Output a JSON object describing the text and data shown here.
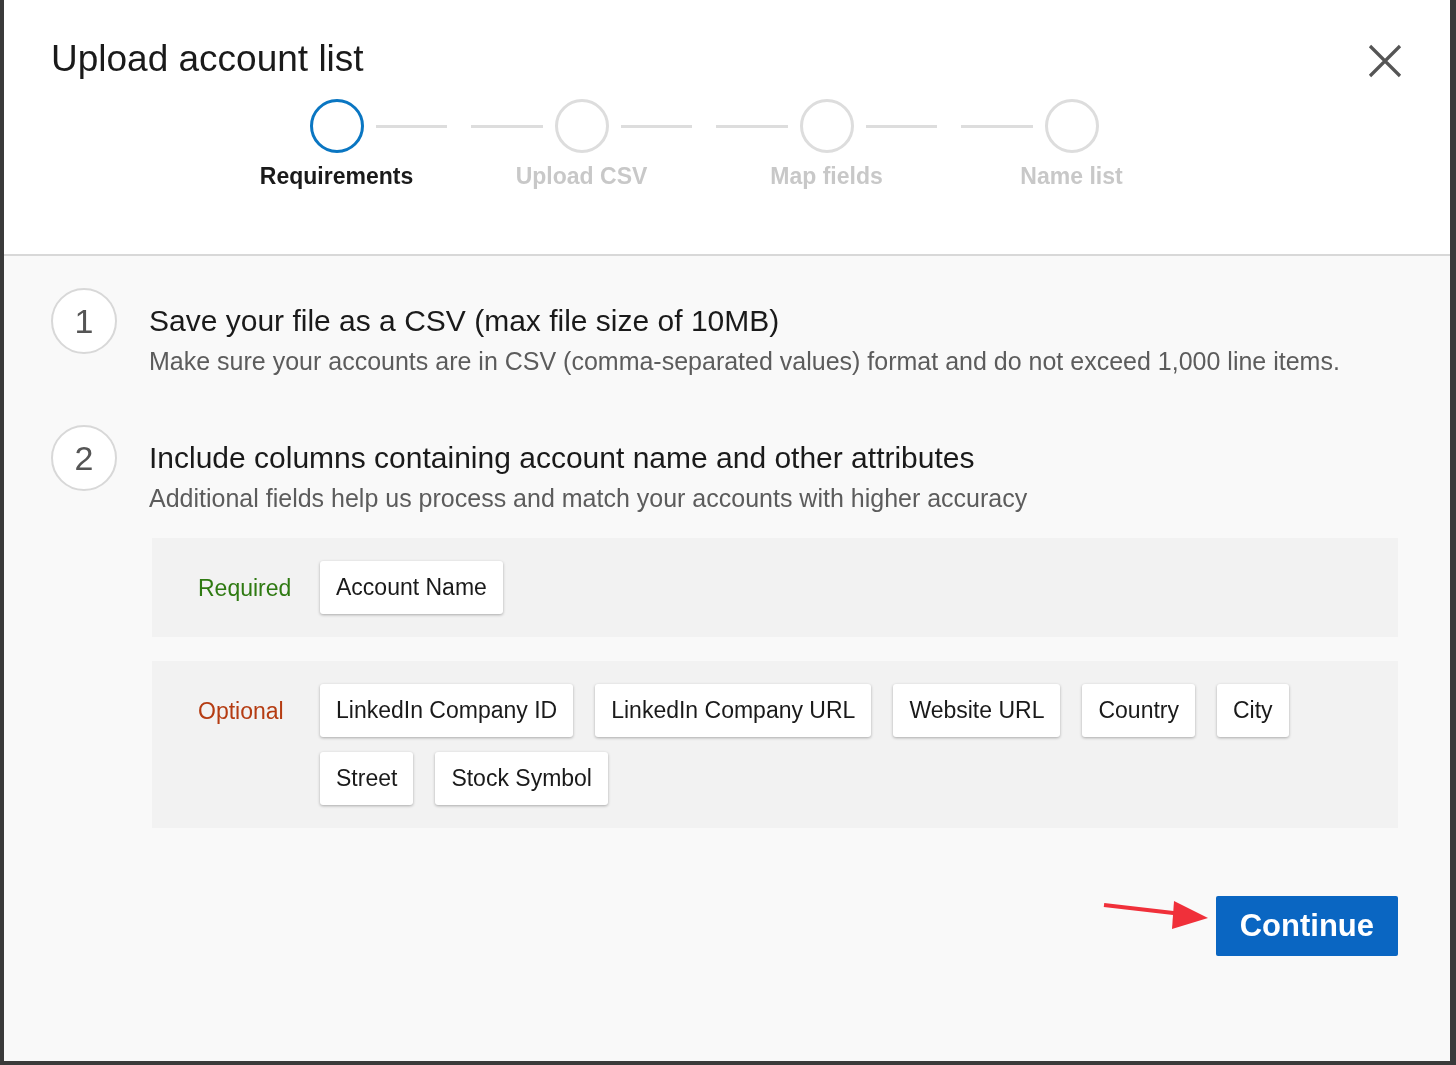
{
  "dialog": {
    "title": "Upload account list"
  },
  "steps": [
    {
      "label": "Requirements",
      "selected": true
    },
    {
      "label": "Upload CSV",
      "selected": false
    },
    {
      "label": "Map fields",
      "selected": false
    },
    {
      "label": "Name list",
      "selected": false
    }
  ],
  "instructions": [
    {
      "number": "1",
      "title": "Save your file as a CSV (max file size of 10MB)",
      "description": "Make sure your accounts are in CSV (comma-separated values) format and do not exceed 1,000 line items."
    },
    {
      "number": "2",
      "title": "Include columns containing account name and other attributes",
      "description": "Additional fields help us process and match your accounts with higher accuracy"
    }
  ],
  "field_groups": [
    {
      "kind": "required",
      "label": "Required",
      "fields": [
        "Account Name"
      ]
    },
    {
      "kind": "optional",
      "label": "Optional",
      "fields": [
        "LinkedIn Company ID",
        "LinkedIn Company URL",
        "Website URL",
        "Country",
        "City",
        "Street",
        "Stock Symbol"
      ]
    }
  ],
  "continue_button": "Continue"
}
